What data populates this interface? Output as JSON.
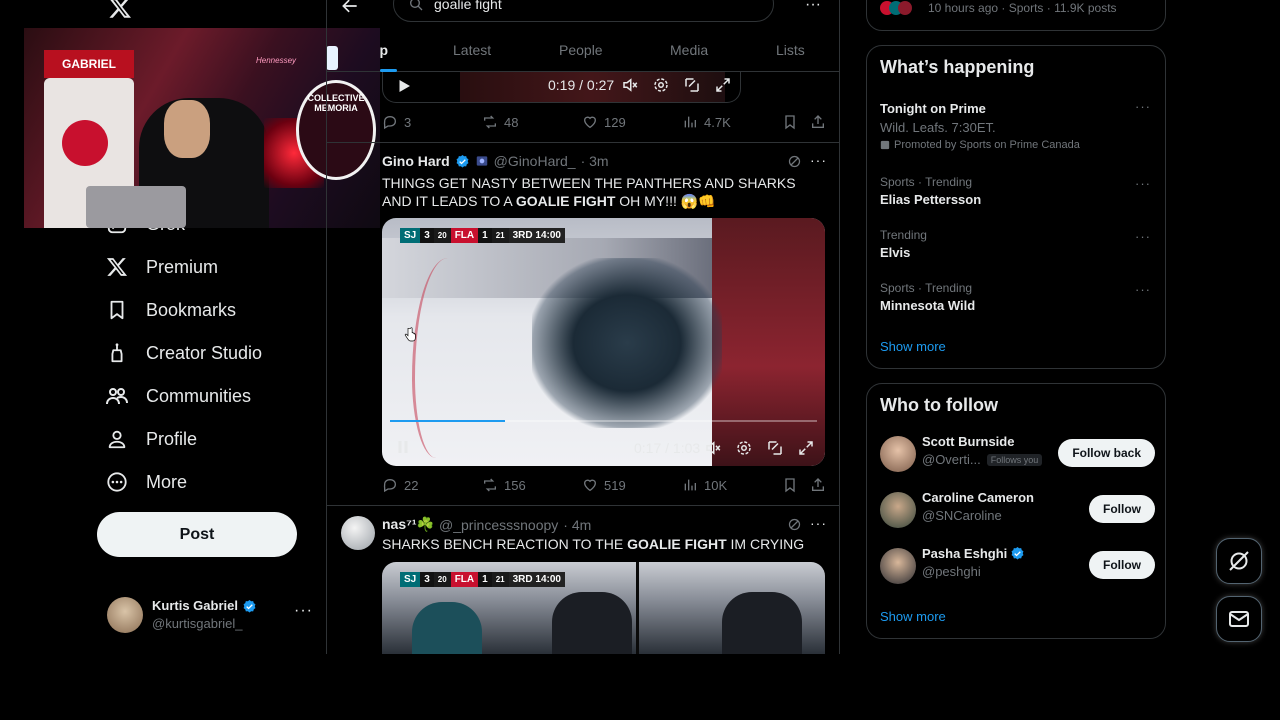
{
  "nav": {
    "items": [
      {
        "label": "Grok",
        "icon": "grok-icon"
      },
      {
        "label": "Premium",
        "icon": "x-premium-icon"
      },
      {
        "label": "Bookmarks",
        "icon": "bookmark-icon"
      },
      {
        "label": "Creator Studio",
        "icon": "creator-studio-icon"
      },
      {
        "label": "Communities",
        "icon": "communities-icon"
      },
      {
        "label": "Profile",
        "icon": "profile-icon"
      },
      {
        "label": "More",
        "icon": "more-circle-icon"
      }
    ],
    "post_label": "Post",
    "account": {
      "name": "Kurtis Gabriel",
      "handle": "@kurtisgabriel_"
    }
  },
  "webcam": {
    "jersey_name": "GABRIEL",
    "sign_text": "COLLECTIVE MEMORIA",
    "neon_text": "Hennessey"
  },
  "search": {
    "query": "goalie fight",
    "tabs": [
      "Top",
      "Latest",
      "People",
      "Media",
      "Lists"
    ],
    "active_tab": "Top"
  },
  "tweets": [
    {
      "video": {
        "time": "0:19 / 0:27"
      },
      "stats": {
        "replies": "3",
        "reposts": "48",
        "likes": "129",
        "views": "4.7K"
      }
    },
    {
      "name": "Gino Hard",
      "handle": "@GinoHard_",
      "time": "· 3m",
      "text_before": "THINGS GET NASTY BETWEEN THE PANTHERS AND SHARKS AND IT LEADS TO A ",
      "text_bold": "GOALIE FIGHT",
      "text_after": " OH MY!!! 😱👊",
      "video": {
        "time": "0:17 / 1:03",
        "progress": 0.27,
        "scorebug": {
          "team1": "SJ",
          "score1": "3",
          "shots1": "20",
          "team2": "FLA",
          "score2": "1",
          "shots2": "21",
          "clock": "3RD 14:00"
        }
      },
      "stats": {
        "replies": "22",
        "reposts": "156",
        "likes": "519",
        "views": "10K"
      }
    },
    {
      "name": "nas⁷¹☘️",
      "handle": "@_princesssnoopy",
      "time": "· 4m",
      "text_before": "SHARKS BENCH REACTION TO THE ",
      "text_bold": "GOALIE FIGHT",
      "text_after": " IM CRYING",
      "video": {
        "scorebug": {
          "team1": "SJ",
          "score1": "3",
          "shots1": "20",
          "team2": "FLA",
          "score2": "1",
          "shots2": "21",
          "clock": "3RD 14:00"
        }
      }
    }
  ],
  "right": {
    "top_card_meta": "10 hours ago · Sports · 11.9K posts",
    "happening_title": "What’s happening",
    "trends": [
      {
        "title": "Tonight on Prime",
        "subtitle": "Wild. Leafs. 7:30ET.",
        "promo": "Promoted by Sports on Prime Canada"
      },
      {
        "meta": "Sports · Trending",
        "name": "Elias Pettersson"
      },
      {
        "meta": "Trending",
        "name": "Elvis"
      },
      {
        "meta": "Sports · Trending",
        "name": "Minnesota Wild"
      }
    ],
    "show_more": "Show more",
    "follow_title": "Who to follow",
    "follow": [
      {
        "name": "Scott Burnside",
        "handle": "@Overti...",
        "badge": "Follows you",
        "button": "Follow back"
      },
      {
        "name": "Caroline Cameron",
        "handle": "@SNCaroline",
        "button": "Follow"
      },
      {
        "name": "Pasha Eshghi",
        "handle": "@peshghi",
        "button": "Follow",
        "verified": true
      }
    ],
    "follow_show_more": "Show more"
  },
  "colors": {
    "accent": "#1d9bf0",
    "background": "#000000",
    "border": "#2f3336",
    "muted": "#71767b"
  }
}
